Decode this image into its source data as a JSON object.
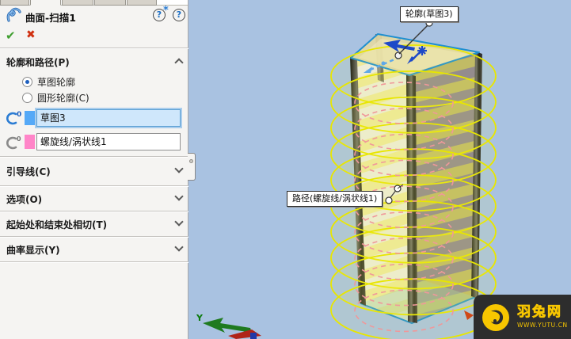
{
  "panel": {
    "title": "曲面-扫描1",
    "icons": {
      "confirm": "✔",
      "cancel": "✖",
      "help": "?",
      "help_star": "*"
    },
    "sections": {
      "profile_path": {
        "label": "轮廓和路径(P)",
        "radio_sketch": "草图轮廓",
        "radio_circular": "圆形轮廓(C)",
        "profile_icon_digit": "0",
        "path_icon_digit": "0",
        "profile_field": {
          "value": "草图3"
        },
        "path_field": {
          "value": "螺旋线/涡状线1"
        }
      },
      "collapsed": [
        {
          "label": "引导线(C)"
        },
        {
          "label": "选项(O)"
        },
        {
          "label": "起始处和结束处相切(T)"
        },
        {
          "label": "曲率显示(Y)"
        }
      ]
    }
  },
  "viewport": {
    "profile_callout": "轮廓(草图3)",
    "path_callout": "路径(螺旋线/涡状线1)",
    "triad_y_label": "Y"
  },
  "watermark": {
    "brand": "羽兔网",
    "url": "WWW.YUTU.CN"
  },
  "colors": {
    "viewport_bg": "#a9c2e1",
    "panel_bg": "#f5f4f2",
    "selection_blue": "#55a9f7",
    "selection_pink": "#ff85c8",
    "helix_yellow": "#e8e600",
    "path_pink": "#f0989a",
    "edge_blue": "#1f8fd0",
    "watermark_yellow": "#f7c600"
  }
}
